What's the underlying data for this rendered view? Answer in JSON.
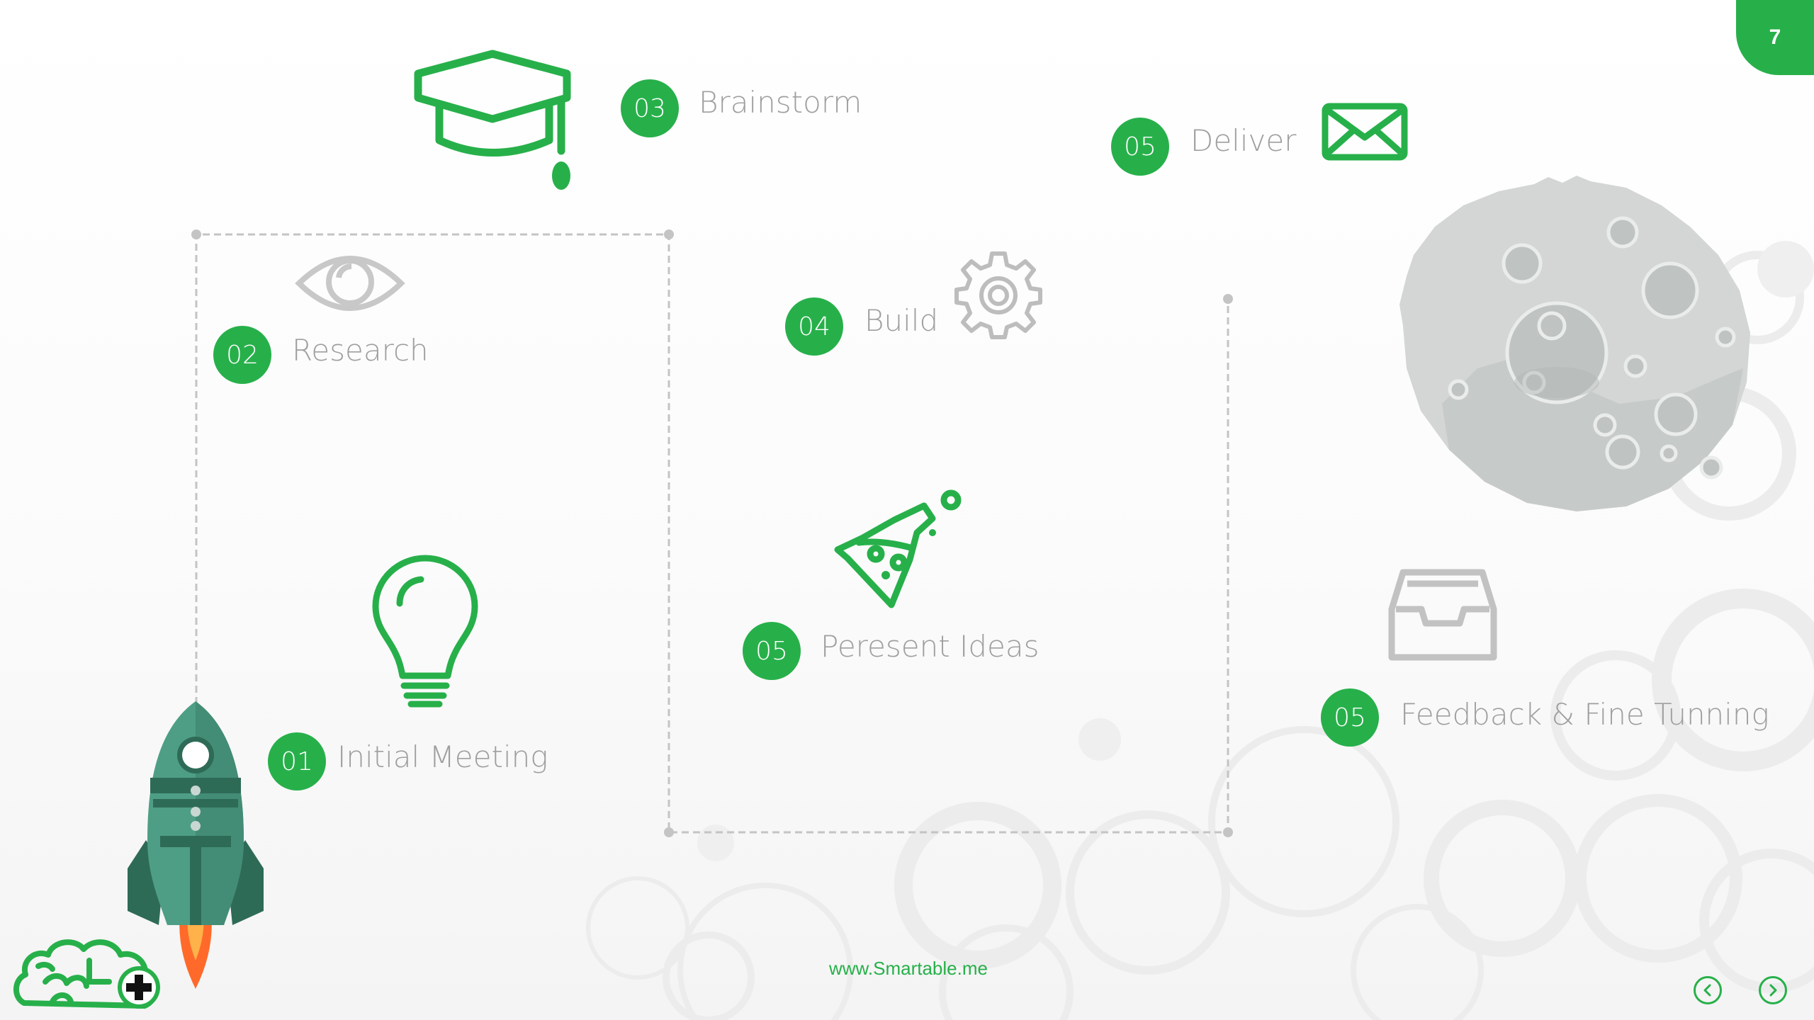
{
  "page": {
    "number": "7",
    "footer_url": "www.Smartable.me"
  },
  "steps": [
    {
      "number": "01",
      "label": "Initial Meeting",
      "icon": "lightbulb-icon"
    },
    {
      "number": "02",
      "label": "Research",
      "icon": "eye-icon"
    },
    {
      "number": "03",
      "label": "Brainstorm",
      "icon": "graduation-cap-icon"
    },
    {
      "number": "04",
      "label": "Build",
      "icon": "gear-icon"
    },
    {
      "number": "05",
      "label": "Peresent Ideas",
      "icon": "flask-icon"
    },
    {
      "number": "05",
      "label": "Deliver",
      "icon": "envelope-icon"
    },
    {
      "number": "05",
      "label": "Feedback & Fine Tunning",
      "icon": "inbox-tray-icon"
    }
  ],
  "colors": {
    "accent": "#27b04a",
    "gray": "#9f9f9f"
  },
  "nav": {
    "prev_icon": "chevron-left-icon",
    "next_icon": "chevron-right-icon"
  }
}
